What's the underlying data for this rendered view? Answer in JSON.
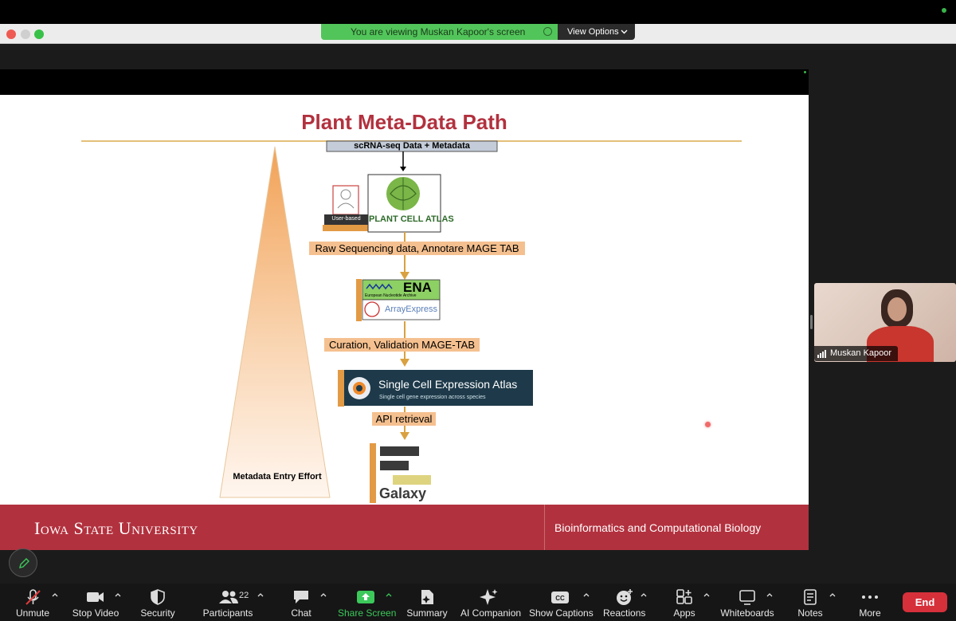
{
  "banner": {
    "text": "You are viewing Muskan Kapoor's screen",
    "view_options": "View Options"
  },
  "slide": {
    "title": "Plant Meta-Data Path",
    "top_box": "scRNA-seq Data + Metadata",
    "user_based": "User-based",
    "pca_line1": "PLANT CELL ATLAS",
    "step1": "Raw Sequencing data, Annotare MAGE TAB",
    "ena": "ENA",
    "ena_sub": "European Nucleotide Archive",
    "arrayexpress": "ArrayExpress",
    "step2": "Curation, Validation MAGE-TAB",
    "scea_title": "Single Cell Expression Atlas",
    "scea_sub": "Single cell gene expression across species",
    "step3": "API retrieval",
    "galaxy": "Galaxy",
    "effort": "Metadata Entry Effort",
    "footer_left": "Iowa State University",
    "footer_right": "Bioinformatics and Computational Biology"
  },
  "video": {
    "name": "Muskan Kapoor"
  },
  "toolbar": {
    "unmute": "Unmute",
    "stop_video": "Stop Video",
    "security": "Security",
    "participants": "Participants",
    "participants_count": "22",
    "chat": "Chat",
    "share_screen": "Share Screen",
    "summary": "Summary",
    "ai_companion": "AI Companion",
    "show_captions": "Show Captions",
    "reactions": "Reactions",
    "apps": "Apps",
    "whiteboards": "Whiteboards",
    "notes": "Notes",
    "more": "More",
    "end": "End"
  },
  "colors": {
    "accent_red": "#b2313e",
    "zoom_green": "#52c55a",
    "end_red": "#d6303b",
    "flow_orange": "#f5c08f",
    "arrow_gold": "#d9a140"
  }
}
